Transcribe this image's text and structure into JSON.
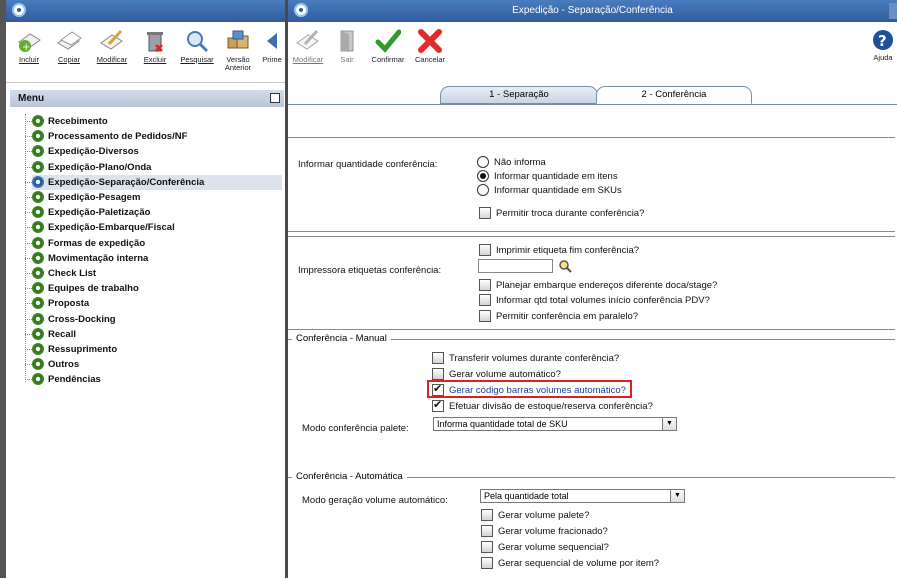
{
  "left_window": {
    "toolbar": [
      {
        "name": "incluir-button",
        "label": "Incluir",
        "icon": "add-document-icon"
      },
      {
        "name": "copiar-button",
        "label": "Copiar",
        "icon": "copy-document-icon"
      },
      {
        "name": "modificar-button",
        "label": "Modificar",
        "icon": "edit-pencil-icon"
      },
      {
        "name": "excluir-button",
        "label": "Excluir",
        "icon": "trash-icon"
      },
      {
        "name": "pesquisar-button",
        "label": "Pesquisar",
        "icon": "magnifier-icon"
      },
      {
        "name": "versao-anterior-button",
        "label": "Versão Anterior",
        "icon": "boxes-icon"
      },
      {
        "name": "primeiro-button",
        "label": "Prime",
        "icon": "arrow-left-icon"
      }
    ]
  },
  "menu": {
    "title": "Menu",
    "items": [
      "Recebimento",
      "Processamento de Pedidos/NF",
      "Expedição-Diversos",
      "Expedição-Plano/Onda",
      "Expedição-Separação/Conferência",
      "Expedição-Pesagem",
      "Expedição-Paletização",
      "Expedição-Embarque/Fiscal",
      "Formas de expedição",
      "Movimentação interna",
      "Check List",
      "Equipes de trabalho",
      "Proposta",
      "Cross-Docking",
      "Recall",
      "Ressuprimento",
      "Outros",
      "Pendências"
    ],
    "selected_index": 4
  },
  "window": {
    "title": "Expedição - Separação/Conferência",
    "toolbar": {
      "modificar": "Modificar",
      "sair": "Sair",
      "confirmar": "Confirmar",
      "cancelar": "Cancelar",
      "ajuda": "Ajuda"
    },
    "tabs": [
      "1 - Separação",
      "2 - Conferência"
    ],
    "active_tab": 1
  },
  "form": {
    "informar_qtd_label": "Informar quantidade conferência:",
    "informar_qtd_options": [
      "Não informa",
      "Informar quantidade em itens",
      "Informar quantidade em SKUs"
    ],
    "informar_qtd_selected": 1,
    "permitir_troca": "Permitir troca durante conferência?",
    "imprimir_etiqueta": "Imprimir etiqueta fim conferência?",
    "impressora_label": "Impressora etiquetas conferência:",
    "impressora_value": "",
    "planejar_embarque": "Planejar embarque endereços diferente doca/stage?",
    "informar_qtd_volumes": "Informar qtd total volumes início conferência PDV?",
    "permitir_paralelo": "Permitir conferência em paralelo?",
    "manual_legend": "Conferência - Manual",
    "transferir_volumes": "Transferir volumes durante conferência?",
    "gerar_volume_auto": "Gerar volume automático?",
    "gerar_codigo_barras": "Gerar código barras volumes automático?",
    "efetuar_divisao": "Efetuar divisão de estoque/reserva conferência?",
    "modo_palete_label": "Modo conferência palete:",
    "modo_palete_value": "Informa quantidade total de SKU",
    "auto_legend": "Conferência - Automática",
    "modo_geracao_label": "Modo geração volume automático:",
    "modo_geracao_value": "Pela quantidade total",
    "gerar_volume_palete": "Gerar volume palete?",
    "gerar_volume_fracionado": "Gerar volume fracionado?",
    "gerar_volume_sequencial": "Gerar volume sequencial?",
    "gerar_sequencial_item": "Gerar sequencial de volume por item?"
  }
}
